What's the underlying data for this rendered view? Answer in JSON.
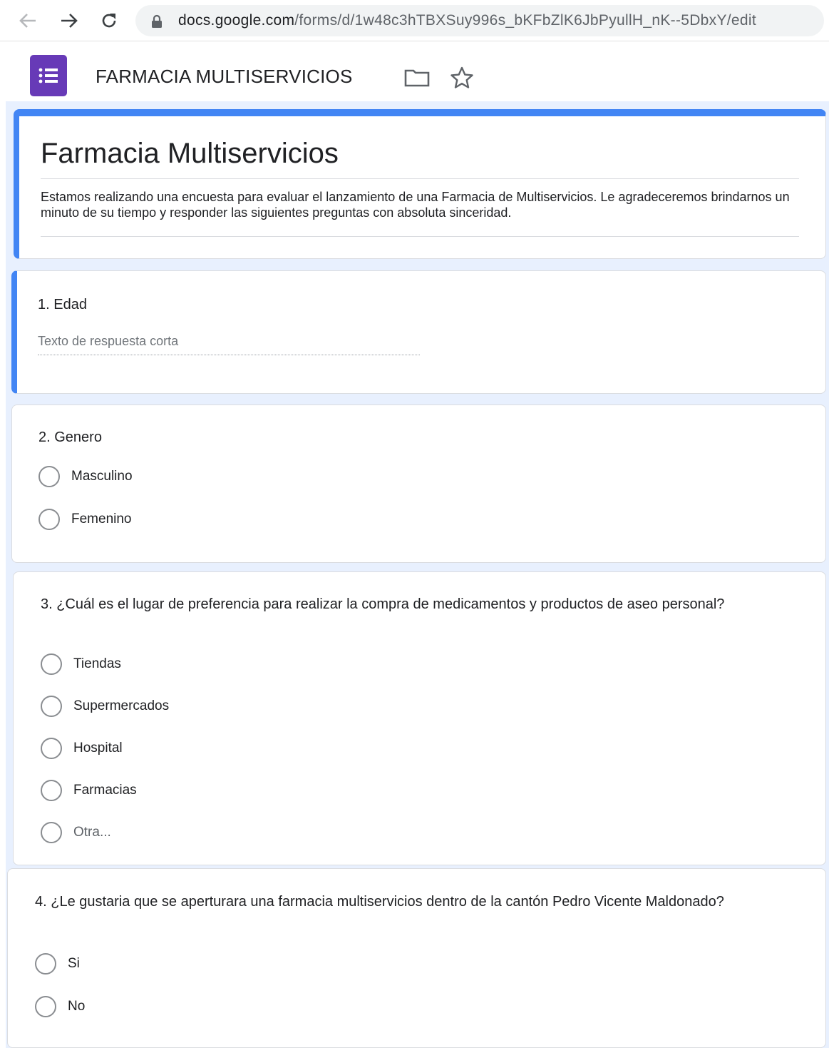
{
  "browser": {
    "url_host": "docs.google.com",
    "url_path": "/forms/d/1w48c3hTBXSuy996s_bKFbZlK6JbPyullH_nK--5DbxY/edit"
  },
  "header": {
    "doc_title": "FARMACIA MULTISERVICIOS"
  },
  "form": {
    "title": "Farmacia Multiservicios",
    "description": "Estamos realizando una encuesta para evaluar el lanzamiento de una Farmacia de Multiservicios. Le agradeceremos brindarnos un minuto de su tiempo y responder las siguientes preguntas con absoluta sinceridad.",
    "accent_color": "#4285f4",
    "brand_color": "#673ab7"
  },
  "questions": [
    {
      "title": "1. Edad",
      "placeholder": "Texto de respuesta corta"
    },
    {
      "title": "2. Genero",
      "options": [
        "Masculino",
        "Femenino"
      ]
    },
    {
      "title": "3. ¿Cuál es el lugar de preferencia para realizar la compra de medicamentos y productos de aseo personal?",
      "options": [
        "Tiendas",
        "Supermercados",
        "Hospital",
        "Farmacias",
        "Otra..."
      ]
    },
    {
      "title": "4. ¿Le gustaria que se aperturara una farmacia multiservicios dentro de la cantón Pedro Vicente Maldonado?",
      "options": [
        "Si",
        "No"
      ]
    }
  ]
}
